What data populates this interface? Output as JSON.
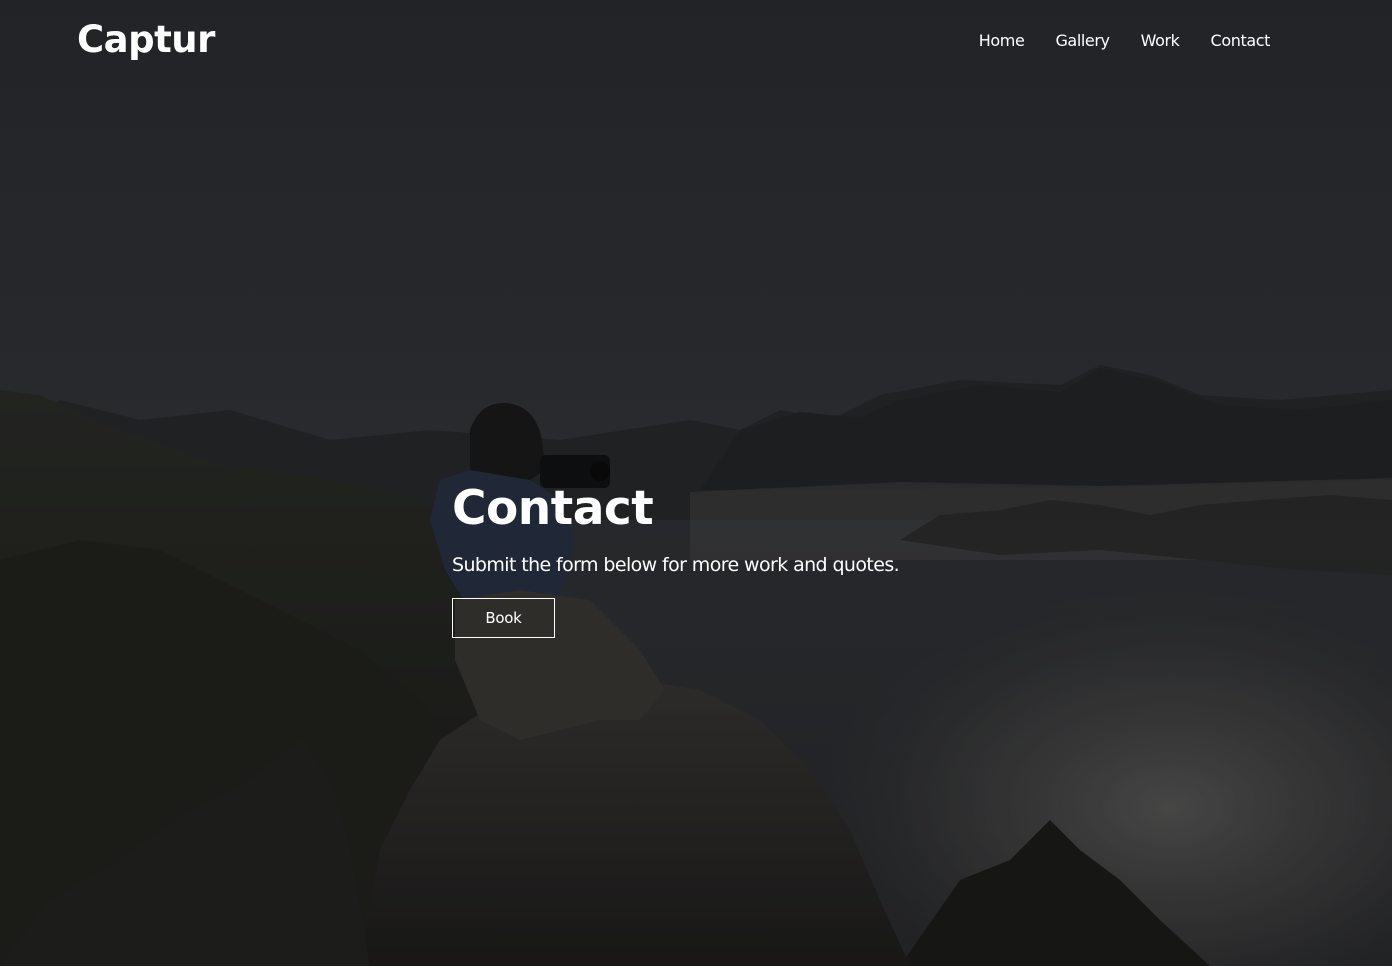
{
  "brand": {
    "name": "Captur"
  },
  "nav": {
    "items": [
      {
        "label": "Home"
      },
      {
        "label": "Gallery"
      },
      {
        "label": "Work"
      },
      {
        "label": "Contact"
      }
    ]
  },
  "hero": {
    "title": "Contact",
    "subtitle": "Submit the form below for more work and quotes.",
    "button_label": "Book"
  }
}
